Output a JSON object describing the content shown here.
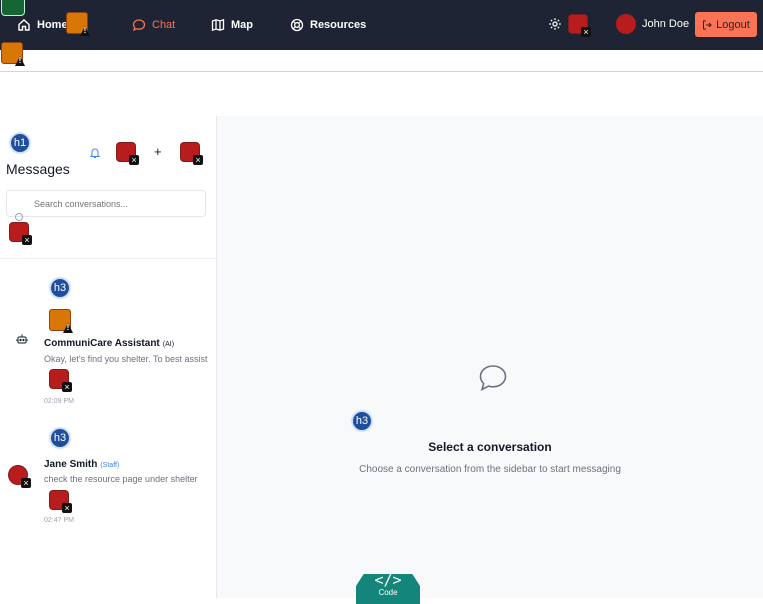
{
  "nav": {
    "home_label": "Home",
    "chat_label": "Chat",
    "map_label": "Map",
    "resources_label": "Resources",
    "user_name": "John Doe",
    "logout_label": "Logout",
    "accent_color": "#f97354",
    "bg_color": "#1e2433"
  },
  "sidebar": {
    "heading_badge": "h1",
    "title": "Messages",
    "search_placeholder": "Search conversations...",
    "conversations": [
      {
        "heading_badge": "h3",
        "name": "CommuniCare Assistant",
        "role": "(AI)",
        "preview": "Okay, let's find you shelter. To best assist",
        "time": "02:09 PM",
        "avatar_icon": "robot-icon"
      },
      {
        "heading_badge": "h3",
        "name": "Jane Smith",
        "role": "(Staff)",
        "preview": "check the resource page under shelter",
        "time": "02:47 PM",
        "avatar_icon": "user-avatar-broken-icon"
      }
    ]
  },
  "main": {
    "heading_badge": "h3",
    "empty_title": "Select a conversation",
    "empty_subtitle": "Choose a conversation from the sidebar to start messaging"
  },
  "code_badge": {
    "glyph": "</>",
    "label": "Code"
  }
}
